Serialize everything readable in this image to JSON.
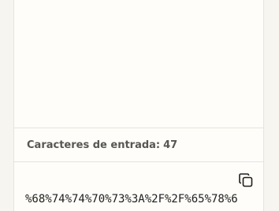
{
  "input": {
    "count_label": "Caracteres de entrada:",
    "count_value": "47"
  },
  "output": {
    "encoded_text": "%68%74%74%70%73%3A%2F%2F%65%78%6",
    "copy_icon": "copy-icon"
  },
  "colors": {
    "panel_bg": "#fefdfa",
    "page_bg": "#f6f5f0",
    "border": "#e6e4de",
    "label_text": "#575651"
  }
}
